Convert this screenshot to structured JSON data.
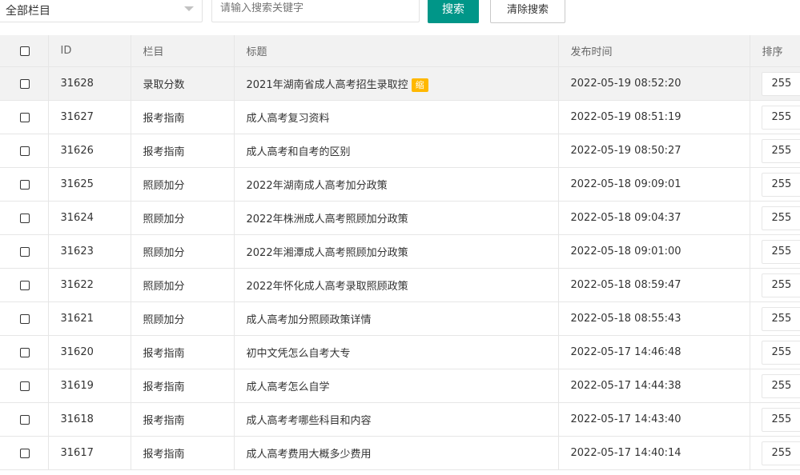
{
  "toolbar": {
    "category_select": "全部栏目",
    "search_placeholder": "请输入搜索关键字",
    "search_button": "搜索",
    "clear_button": "清除搜索"
  },
  "table": {
    "headers": [
      "ID",
      "栏目",
      "标题",
      "发布时间",
      "排序"
    ],
    "rows": [
      {
        "id": "31628",
        "category": "录取分数",
        "title": "2021年湖南省成人高考招生录取控",
        "badge": "缩",
        "time": "2022-05-19 08:52:20",
        "sort": "255"
      },
      {
        "id": "31627",
        "category": "报考指南",
        "title": "成人高考复习资料",
        "time": "2022-05-19 08:51:19",
        "sort": "255"
      },
      {
        "id": "31626",
        "category": "报考指南",
        "title": "成人高考和自考的区别",
        "time": "2022-05-19 08:50:27",
        "sort": "255"
      },
      {
        "id": "31625",
        "category": "照顾加分",
        "title": "2022年湖南成人高考加分政策",
        "time": "2022-05-18 09:09:01",
        "sort": "255"
      },
      {
        "id": "31624",
        "category": "照顾加分",
        "title": "2022年株洲成人高考照顾加分政策",
        "time": "2022-05-18 09:04:37",
        "sort": "255"
      },
      {
        "id": "31623",
        "category": "照顾加分",
        "title": "2022年湘潭成人高考照顾加分政策",
        "time": "2022-05-18 09:01:00",
        "sort": "255"
      },
      {
        "id": "31622",
        "category": "照顾加分",
        "title": "2022年怀化成人高考录取照顾政策",
        "time": "2022-05-18 08:59:47",
        "sort": "255"
      },
      {
        "id": "31621",
        "category": "照顾加分",
        "title": "成人高考加分照顾政策详情",
        "time": "2022-05-18 08:55:43",
        "sort": "255"
      },
      {
        "id": "31620",
        "category": "报考指南",
        "title": "初中文凭怎么自考大专",
        "time": "2022-05-17 14:46:48",
        "sort": "255"
      },
      {
        "id": "31619",
        "category": "报考指南",
        "title": "成人高考怎么自学",
        "time": "2022-05-17 14:44:38",
        "sort": "255"
      },
      {
        "id": "31618",
        "category": "报考指南",
        "title": "成人高考考哪些科目和内容",
        "time": "2022-05-17 14:43:40",
        "sort": "255"
      },
      {
        "id": "31617",
        "category": "报考指南",
        "title": "成人高考费用大概多少费用",
        "time": "2022-05-17 14:40:14",
        "sort": "255"
      }
    ]
  },
  "colors": {
    "primary": "#009688",
    "badge": "#ffb800",
    "header_bg": "#f2f2f2"
  }
}
